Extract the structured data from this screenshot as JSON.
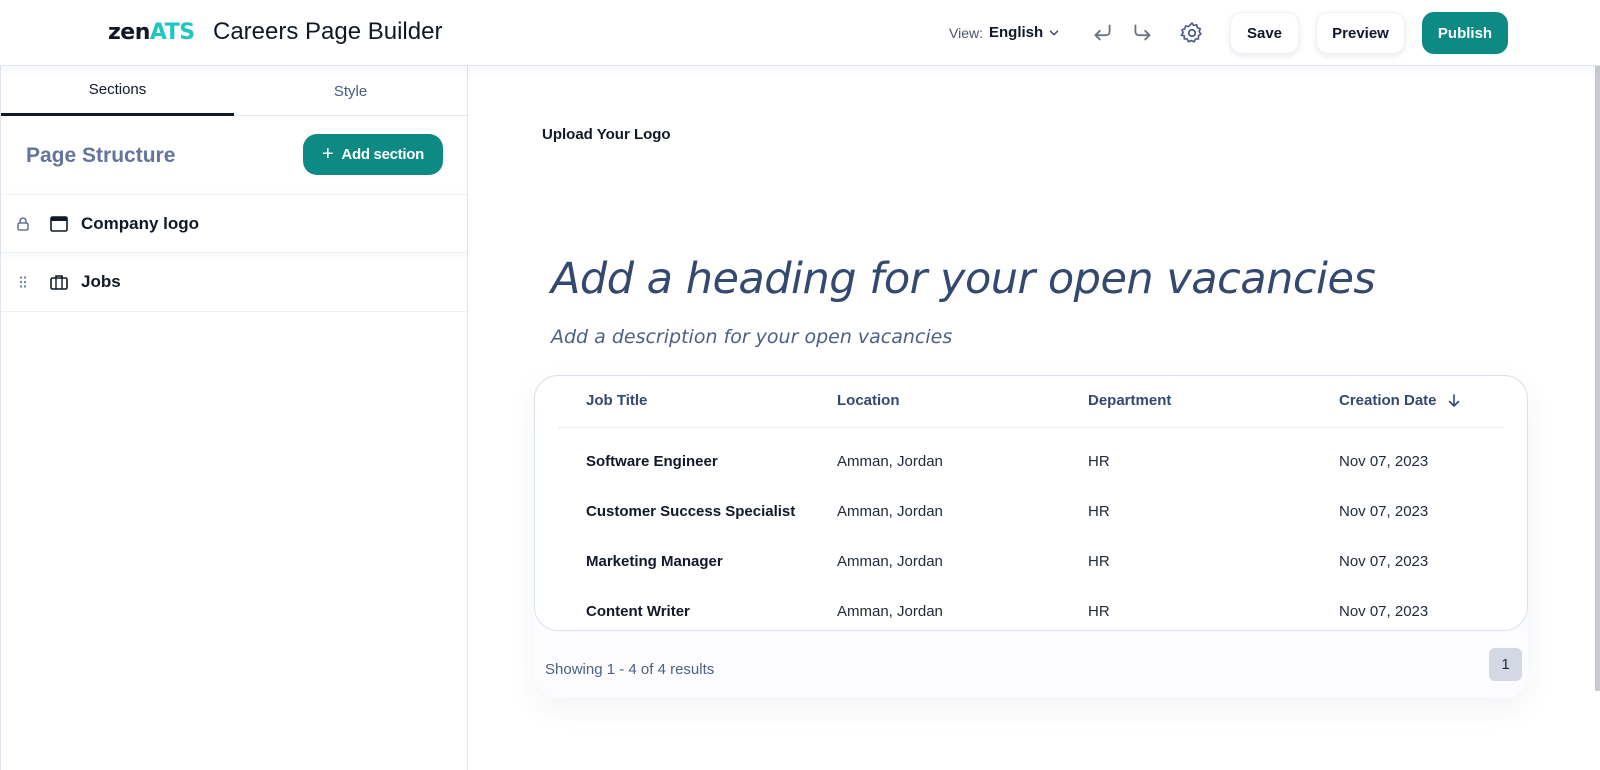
{
  "header": {
    "logo_zen": "zen",
    "logo_ats": "ATS",
    "title": "Careers Page Builder",
    "view_label": "View:",
    "view_value": "English",
    "save_label": "Save",
    "preview_label": "Preview",
    "publish_label": "Publish",
    "icons": [
      "chevron-down-icon",
      "undo-icon",
      "redo-icon",
      "gear-icon"
    ]
  },
  "sidebar": {
    "tabs": [
      {
        "label": "Sections",
        "active": true
      },
      {
        "label": "Style",
        "active": false
      }
    ],
    "page_structure_title": "Page Structure",
    "add_section_label": "Add section",
    "sections": [
      {
        "label": "Company logo",
        "lead_icon": "lock-icon",
        "type_icon": "browser-window-icon"
      },
      {
        "label": "Jobs",
        "lead_icon": "drag-handle-icon",
        "type_icon": "briefcase-icon"
      }
    ]
  },
  "canvas": {
    "upload_logo": "Upload Your Logo",
    "heading": "Add a heading for your open vacancies",
    "description": "Add a description for your open vacancies",
    "table": {
      "columns": [
        "Job Title",
        "Location",
        "Department",
        "Creation Date"
      ],
      "rows": [
        [
          "Software Engineer",
          "Amman, Jordan",
          "HR",
          "Nov 07, 2023"
        ],
        [
          "Customer Success Specialist",
          "Amman, Jordan",
          "HR",
          "Nov 07, 2023"
        ],
        [
          "Marketing Manager",
          "Amman, Jordan",
          "HR",
          "Nov 07, 2023"
        ],
        [
          "Content Writer",
          "Amman, Jordan",
          "HR",
          "Nov 07, 2023"
        ]
      ]
    },
    "results_text": "Showing 1 - 4 of 4 results",
    "current_page": "1"
  },
  "colors": {
    "accent": "#0d8a83",
    "logo_ats": "#1cc7c1",
    "heading": "#34496f"
  }
}
